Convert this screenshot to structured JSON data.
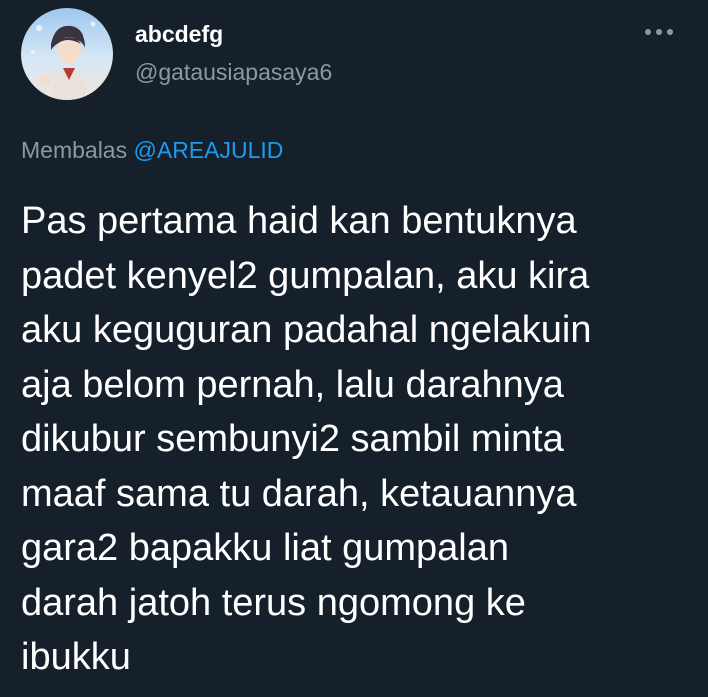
{
  "tweet": {
    "author": {
      "display_name": "abcdefg",
      "handle": "@gatausiapasaya6",
      "avatar_icon": "anime-profile-avatar"
    },
    "more_icon": "more-horizontal-icon",
    "reply": {
      "prefix": "Membalas",
      "mention": "@AREAJULID"
    },
    "text_lines": [
      "Pas pertama haid kan bentuknya",
      "padet kenyel2 gumpalan, aku kira",
      "aku keguguran padahal ngelakuin",
      "aja belom pernah, lalu darahnya",
      "dikubur sembunyi2 sambil minta",
      "maaf sama tu darah, ketauannya",
      "gara2 bapakku liat gumpalan",
      "darah jatoh terus ngomong ke",
      "ibukku"
    ]
  },
  "colors": {
    "background": "#15202b",
    "primary_text": "#ffffff",
    "secondary_text": "#8b98a5",
    "accent": "#1d9bf0"
  }
}
